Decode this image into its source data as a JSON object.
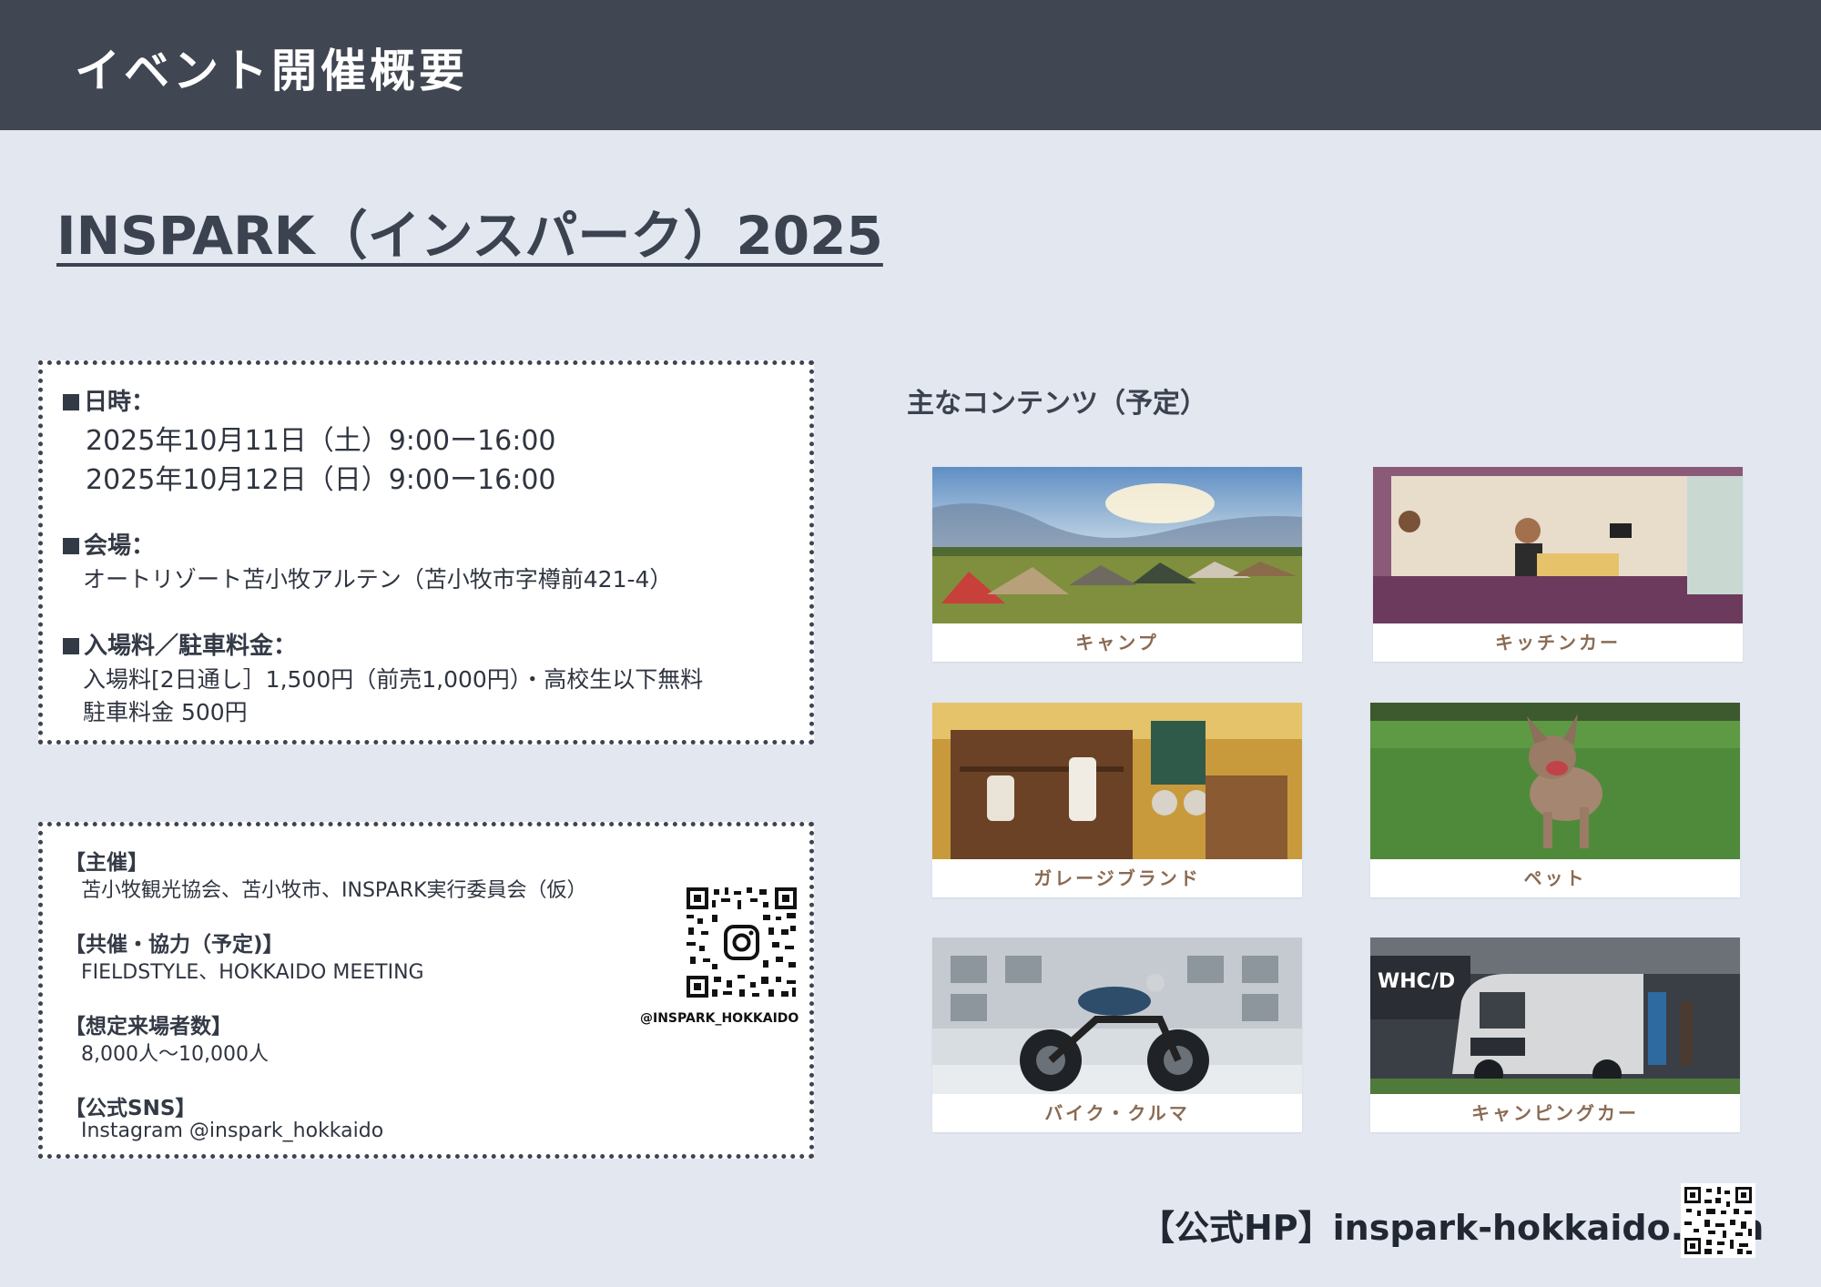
{
  "header": {
    "title": "イベント開催概要"
  },
  "event_title": "INSPARK（インスパーク）2025",
  "details": {
    "date_label": "日時：",
    "date_lines": [
      "2025年10月11日（土）9:00ー16:00",
      "2025年10月12日（日）9:00ー16:00"
    ],
    "venue_label": "会場：",
    "venue": "オートリゾート苫小牧アルテン（苫小牧市字樽前421-4）",
    "fee_label": "入場料／駐車料金：",
    "fee_lines": [
      "入場料[2日通し］1,500円（前売1,000円）・高校生以下無料",
      "駐車料金 500円"
    ]
  },
  "info": {
    "organizer_label": "【主催】",
    "organizer": "苫小牧観光協会、苫小牧市、INSPARK実行委員会（仮）",
    "cosponsor_label": "【共催・協力（予定)】",
    "cosponsor": "FIELDSTYLE、HOKKAIDO MEETING",
    "visitors_label": "【想定来場者数】",
    "visitors": "8,000人〜10,000人",
    "sns_label": "【公式SNS】",
    "sns": "Instagram @inspark_hokkaido",
    "qr_handle": "@INSPARK_HOKKAIDO"
  },
  "contents": {
    "heading": "主なコンテンツ（予定）",
    "items": [
      {
        "label": "キャンプ"
      },
      {
        "label": "キッチンカー"
      },
      {
        "label": "ガレージブランド"
      },
      {
        "label": "ペット"
      },
      {
        "label": "バイク・クルマ"
      },
      {
        "label": "キャンピングカー"
      }
    ]
  },
  "footer": {
    "hp": "【公式HP】inspark-hokkaido.com"
  },
  "icons": {
    "qr_code": "qr-code-icon",
    "instagram": "instagram-icon"
  }
}
